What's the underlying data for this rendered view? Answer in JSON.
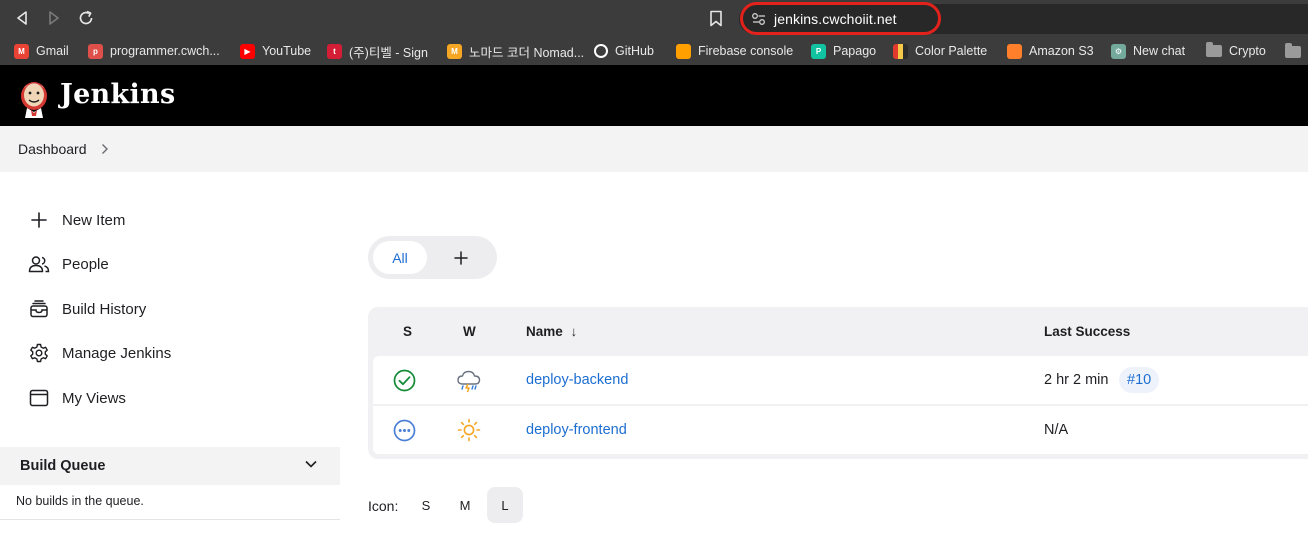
{
  "browser": {
    "url": "jenkins.cwchoiit.net",
    "bookmarks": [
      {
        "label": "Gmail",
        "icon": "gmail-icon",
        "color": "#ea4335",
        "glyph": "M"
      },
      {
        "label": "programmer.cwch...",
        "icon": "favicon-icon",
        "color": "#e0504a",
        "glyph": "p"
      },
      {
        "label": "YouTube",
        "icon": "youtube-icon",
        "color": "#ff0000",
        "glyph": "▶"
      },
      {
        "label": "(주)티벨 - Sign",
        "icon": "favicon-icon",
        "color": "#d41e35",
        "glyph": "t"
      },
      {
        "label": "노마드 코더 Nomad...",
        "icon": "favicon-icon",
        "color": "#f5a623",
        "glyph": "M"
      },
      {
        "label": "GitHub",
        "icon": "github-icon",
        "color": "#ffffff",
        "glyph": ""
      },
      {
        "label": "Firebase console",
        "icon": "firebase-icon",
        "color": "#ffa000",
        "glyph": ""
      },
      {
        "label": "Papago",
        "icon": "papago-icon",
        "color": "#12c3a2",
        "glyph": "P"
      },
      {
        "label": "Color Palette",
        "icon": "palette-icon",
        "color": "#f7c948",
        "glyph": ""
      },
      {
        "label": "Amazon S3",
        "icon": "s3-icon",
        "color": "#ff7f2a",
        "glyph": ""
      },
      {
        "label": "New chat",
        "icon": "chatgpt-icon",
        "color": "#74aa9c",
        "glyph": "⚙"
      },
      {
        "label": "Crypto",
        "icon": "folder-icon",
        "color": "#9a9a9a",
        "glyph": ""
      }
    ]
  },
  "header": {
    "title": "Jenkins"
  },
  "breadcrumb": {
    "root": "Dashboard"
  },
  "sidebar": {
    "tasks": [
      {
        "label": "New Item",
        "icon": "plus-icon"
      },
      {
        "label": "People",
        "icon": "people-icon"
      },
      {
        "label": "Build History",
        "icon": "build-history-icon"
      },
      {
        "label": "Manage Jenkins",
        "icon": "gear-icon"
      },
      {
        "label": "My Views",
        "icon": "window-icon"
      }
    ],
    "build_queue": {
      "title": "Build Queue",
      "empty": "No builds in the queue."
    }
  },
  "views": {
    "active_tab": "All"
  },
  "jobs_table": {
    "columns": {
      "status": "S",
      "weather": "W",
      "name": "Name",
      "sort_indicator": "↓",
      "last_success": "Last Success"
    },
    "rows": [
      {
        "status": "success",
        "weather": "storm",
        "name": "deploy-backend",
        "last_success": "2 hr 2 min",
        "build": "#10"
      },
      {
        "status": "not-built",
        "weather": "sunny",
        "name": "deploy-frontend",
        "last_success": "N/A",
        "build": ""
      }
    ]
  },
  "icon_size": {
    "label": "Icon:",
    "options": [
      "S",
      "M",
      "L"
    ],
    "selected": "L"
  },
  "colors": {
    "link": "#1d6ed1",
    "success": "#138a36",
    "annotation": "#e3221c"
  }
}
